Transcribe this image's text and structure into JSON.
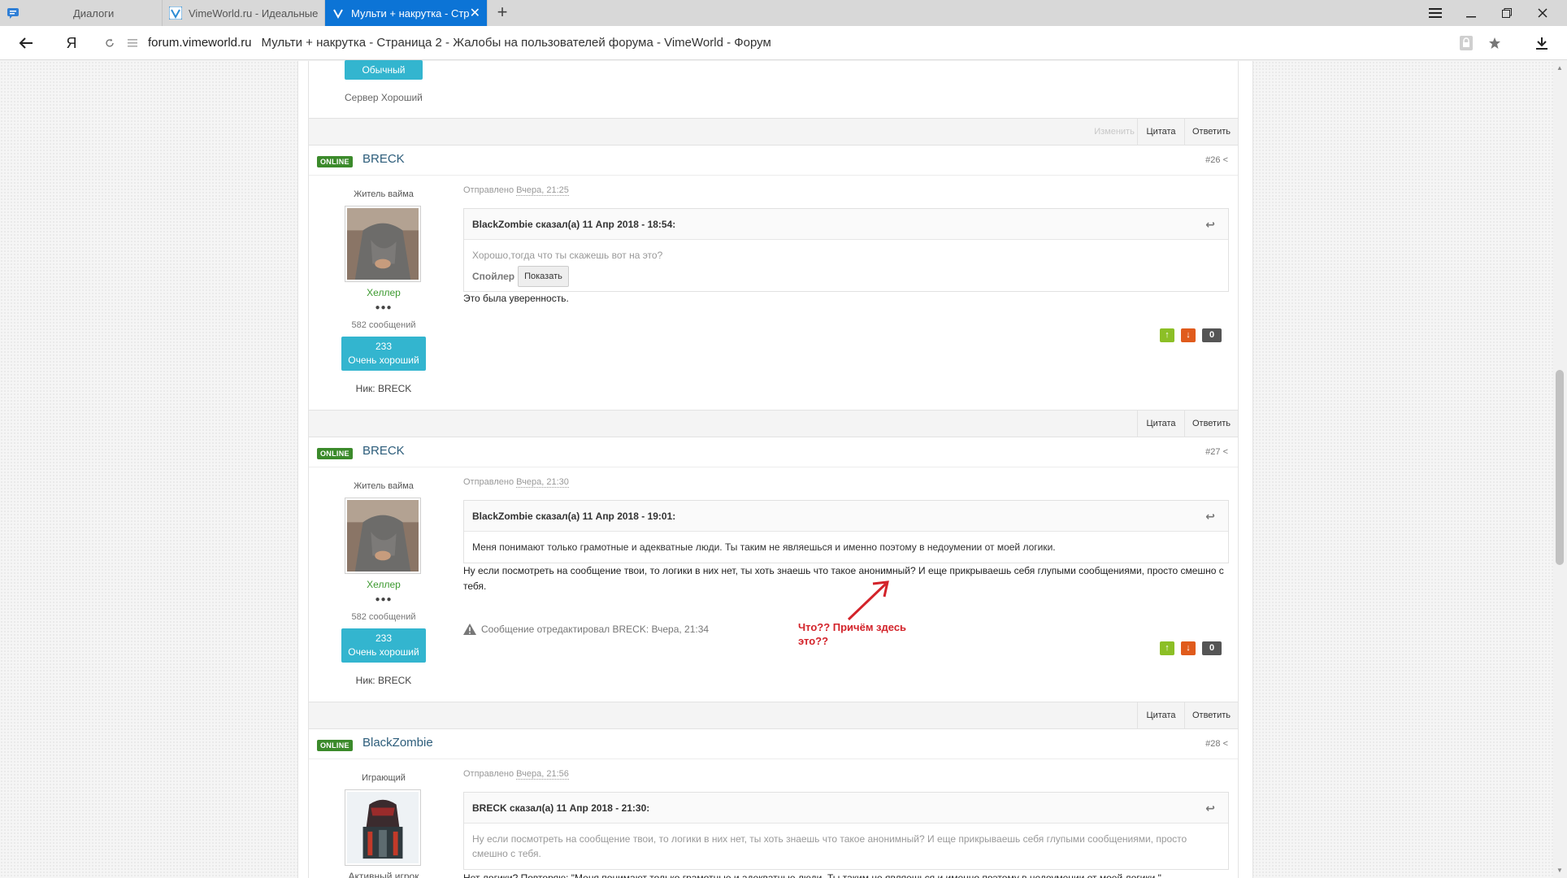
{
  "browser": {
    "tabs": [
      {
        "label": "Диалоги",
        "icon": "chat-bubble-icon",
        "active": false
      },
      {
        "label": "VimeWorld.ru - Идеальные",
        "icon": "vimeworld-logo-icon",
        "active": false
      },
      {
        "label": "Мульти + накрутка - Стр",
        "icon": "vimeworld-logo-icon",
        "active": true
      }
    ],
    "yandex_letter": "Я",
    "address_host": "forum.vimeworld.ru",
    "address_title": "Мульти + накрутка - Страница 2 - Жалобы на пользователей форума - VimeWorld - Форум"
  },
  "prev_post": {
    "rank_label": "Обычный",
    "signature": "Сервер Хороший",
    "actions": {
      "edit": "Изменить",
      "quote": "Цитата",
      "reply": "Ответить"
    }
  },
  "posts": [
    {
      "online_label": "ONLINE",
      "author": "BRECK",
      "number": "#26",
      "group": "Житель вайма",
      "role": "Хеллер",
      "role_dots": "●●●",
      "post_count": "582 сообщений",
      "rep_value": "233",
      "rep_label": "Очень хороший",
      "nick": "Ник: BRECK",
      "posted_prefix": "Отправлено",
      "posted_date": "Вчера, 21:25",
      "quote_head": "BlackZombie сказал(а) 11 Апр 2018 - 18:54:",
      "quote_text": "Хорошо,тогда что ты скажешь вот на это?",
      "spoiler_label": "Спойлер",
      "spoiler_button": "Показать",
      "text": "Это была уверенность.",
      "vote_count": "0",
      "actions": {
        "quote": "Цитата",
        "reply": "Ответить"
      }
    },
    {
      "online_label": "ONLINE",
      "author": "BRECK",
      "number": "#27",
      "group": "Житель вайма",
      "role": "Хеллер",
      "role_dots": "●●●",
      "post_count": "582 сообщений",
      "rep_value": "233",
      "rep_label": "Очень хороший",
      "nick": "Ник: BRECK",
      "posted_prefix": "Отправлено",
      "posted_date": "Вчера, 21:30",
      "quote_head": "BlackZombie сказал(а) 11 Апр 2018 - 19:01:",
      "quote_text": "Меня понимают только грамотные и адекватные люди. Ты таким не являешься и именно поэтому в недоумении от моей логики.",
      "text": "Ну если посмотреть на сообщение твои, то логики в них нет, ты хоть знаешь что такое анонимный? И еще прикрываешь себя глупыми сообщениями, просто смешно с тебя.",
      "edited": "Сообщение отредактировал BRECK: Вчера, 21:34",
      "annotation": "Что?? Причём здесь это??",
      "vote_count": "0",
      "actions": {
        "quote": "Цитата",
        "reply": "Ответить"
      }
    },
    {
      "online_label": "ONLINE",
      "author": "BlackZombie",
      "number": "#28",
      "group": "Играющий",
      "role": "Активный игрок",
      "posted_prefix": "Отправлено",
      "posted_date": "Вчера, 21:56",
      "quote_head": "BRECK сказал(а) 11 Апр 2018 - 21:30:",
      "quote_text": "Ну если посмотреть на сообщение твои, то логики в них нет, ты хоть знаешь что такое анонимный? И еще прикрываешь себя глупыми сообщениями, просто смешно с тебя.",
      "text": "Нет логики? Повторяю: \"Меня понимают только грамотные и адекватные люди. Ты таким не являешься и именно поэтому в недоумении от моей логики.\""
    }
  ],
  "colors": {
    "accent": "#33b5cf",
    "online": "#3b8a2b",
    "tab_active": "#0c74d6",
    "annotation": "#d3232a"
  }
}
